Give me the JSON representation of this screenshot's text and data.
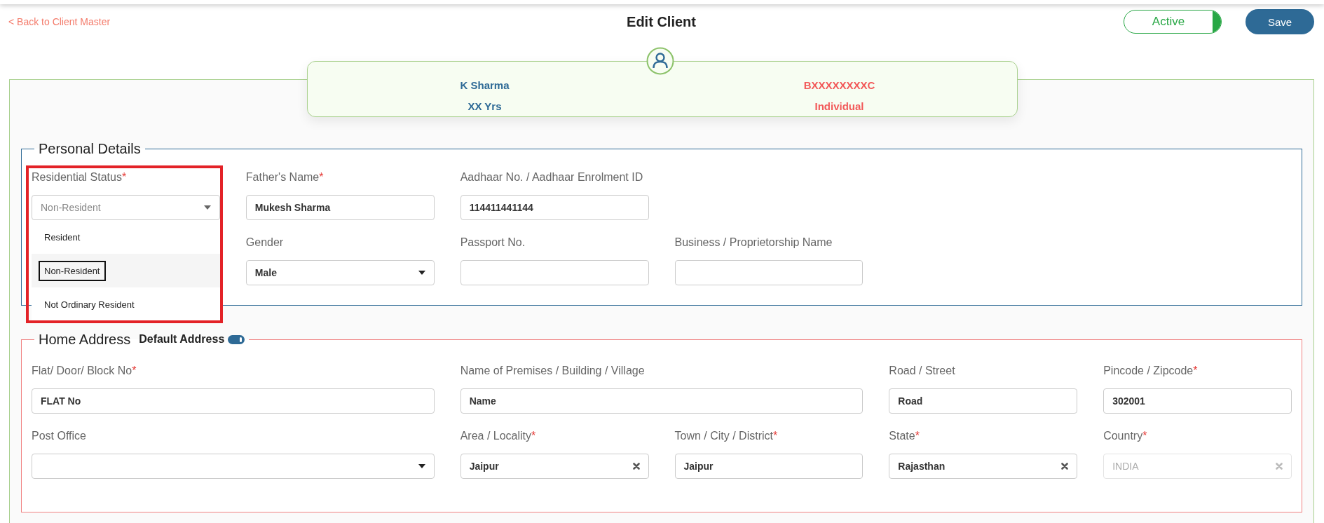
{
  "header": {
    "back_link": "< Back to Client Master",
    "title": "Edit Client",
    "status": {
      "label": "Active",
      "on": true
    },
    "save": "Save"
  },
  "client": {
    "name": "K Sharma",
    "id": "BXXXXXXXXC",
    "age": "XX Yrs",
    "type": "Individual"
  },
  "sections": [
    {
      "title": "Personal Details",
      "color": "#2e6a96",
      "rows": [
        [
          {
            "kind": "select",
            "label": "Residential Status",
            "mark": "*",
            "value": "Non-Resident",
            "wide": false,
            "disabled": false,
            "open": true,
            "highlighted": true,
            "options": [
              {
                "label": "Resident",
                "selected": false
              },
              {
                "label": "Non-Resident",
                "selected": true
              },
              {
                "label": "Not Ordinary Resident",
                "selected": false
              }
            ]
          },
          {
            "kind": "text",
            "label": "Father's Name",
            "mark": "*",
            "value": "Mukesh Sharma",
            "wide": false,
            "disabled": false
          },
          {
            "kind": "text",
            "label": "Aadhaar No. / Aadhaar Enrolment ID",
            "value": "114411441144",
            "wide": false,
            "disabled": false
          }
        ],
        [
          "",
          {
            "kind": "select",
            "label": "Gender",
            "value": "Male",
            "wide": false,
            "disabled": false
          },
          {
            "kind": "text",
            "label": "Passport No.",
            "wide": false,
            "disabled": false
          },
          {
            "kind": "text",
            "label": "Business / Proprietorship Name",
            "wide": false,
            "disabled": false
          }
        ]
      ]
    },
    {
      "title": "Home Address",
      "color": "#f08080",
      "toggle": {
        "label": "Default Address",
        "on": true
      },
      "rows": [
        [
          {
            "kind": "text",
            "label": "Flat/ Door/ Block No",
            "mark": "*",
            "value": "FLAT No",
            "wide": true,
            "disabled": false
          },
          "",
          {
            "kind": "text",
            "label": "Name of Premises / Building / Village",
            "value": "Name",
            "wide": true,
            "disabled": false
          },
          "",
          {
            "kind": "text",
            "label": "Road / Street",
            "value": "Road",
            "wide": false,
            "disabled": false
          },
          {
            "kind": "text",
            "label": "Pincode / Zipcode",
            "mark": "*",
            "value": "302001",
            "wide": false,
            "disabled": false
          }
        ],
        [
          {
            "kind": "select",
            "label": "Post Office",
            "wide": true,
            "disabled": false
          },
          "",
          {
            "kind": "clearable",
            "label": "Area / Locality",
            "mark": "*",
            "value": "Jaipur",
            "wide": false,
            "disabled": false
          },
          {
            "kind": "text",
            "label": "Town / City / District",
            "mark": "*",
            "value": "Jaipur",
            "wide": false,
            "disabled": false
          },
          {
            "kind": "clearable",
            "label": "State",
            "mark": "*",
            "value": "Rajasthan",
            "wide": false,
            "disabled": false
          },
          {
            "kind": "clearable",
            "label": "Country",
            "mark": "*",
            "value": "INDIA",
            "wide": false,
            "disabled": true
          }
        ]
      ]
    }
  ]
}
